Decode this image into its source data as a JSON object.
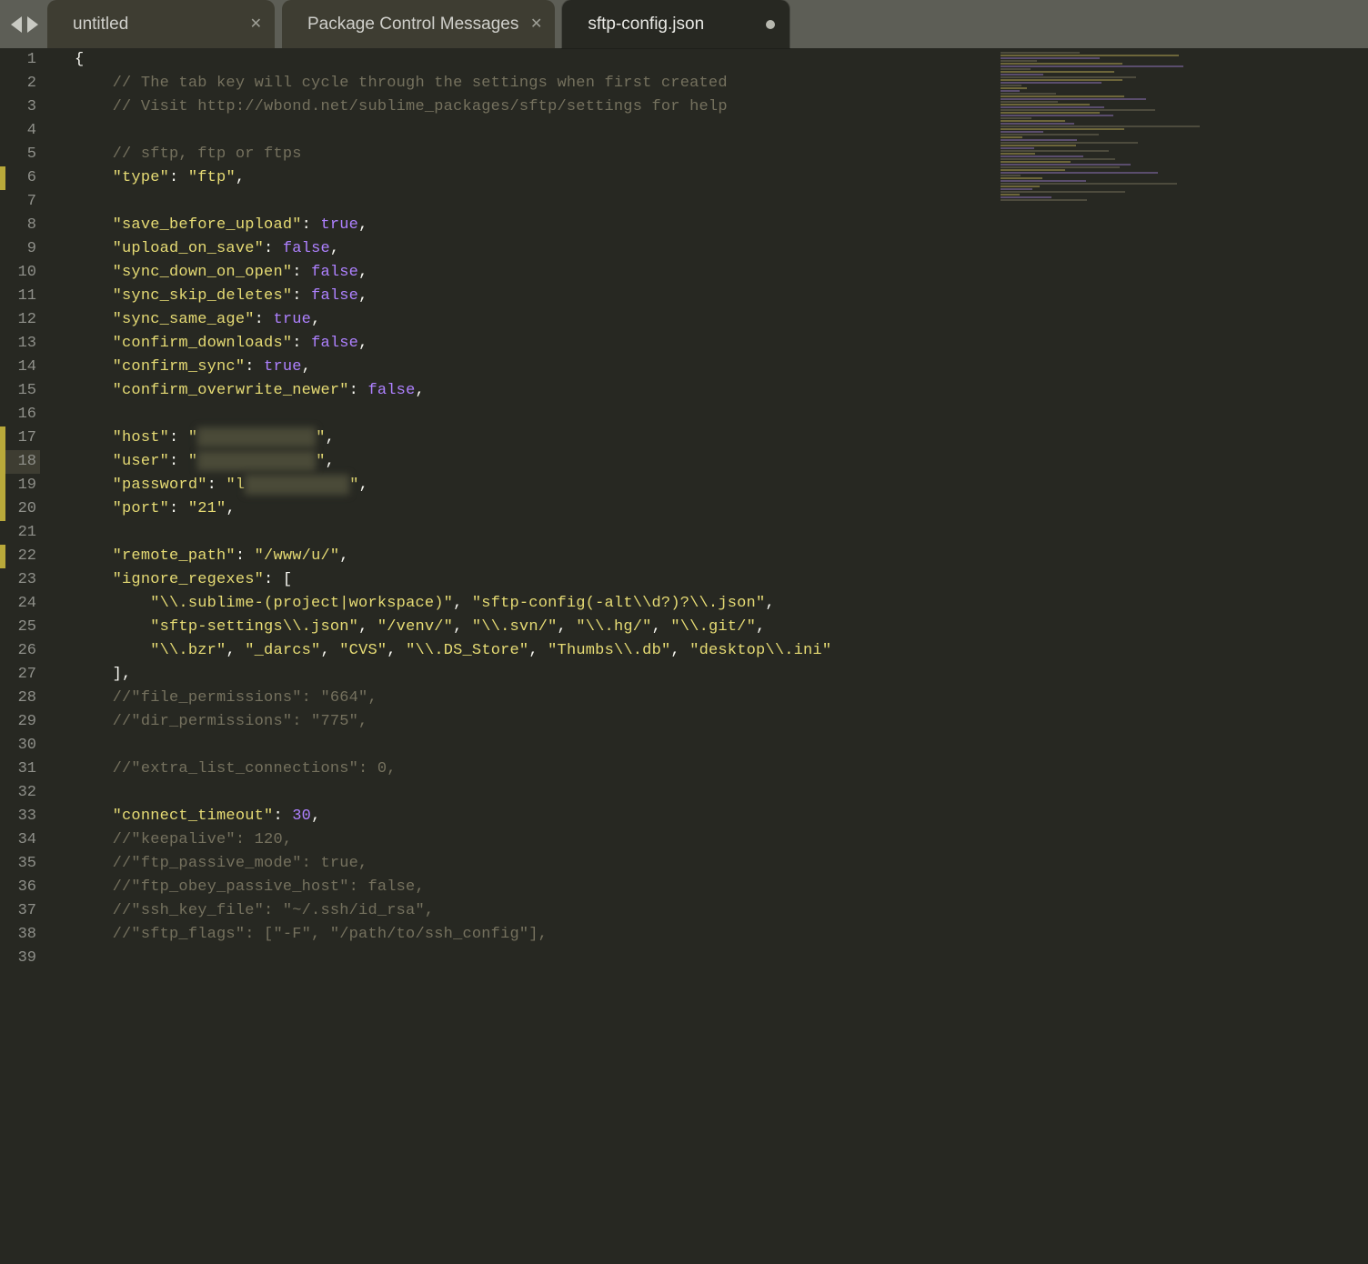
{
  "tabs": [
    {
      "label": "untitled",
      "closeable": true,
      "active": false
    },
    {
      "label": "Package Control Messages",
      "closeable": true,
      "active": false
    },
    {
      "label": "sftp-config.json",
      "closeable": false,
      "dirty": true,
      "active": true
    }
  ],
  "line_numbers": [
    "1",
    "2",
    "3",
    "4",
    "5",
    "6",
    "7",
    "8",
    "9",
    "10",
    "11",
    "12",
    "13",
    "14",
    "15",
    "16",
    "17",
    "18",
    "19",
    "20",
    "21",
    "22",
    "23",
    "24",
    "25",
    "26",
    "27",
    "28",
    "29",
    "30",
    "31",
    "32",
    "33",
    "34",
    "35",
    "36",
    "37",
    "38",
    "39"
  ],
  "modified_lines": [
    6,
    17,
    18,
    19,
    20,
    22
  ],
  "current_line": 18,
  "code": {
    "l1": "{",
    "c2": "// The tab key will cycle through the settings when first created",
    "c3": "// Visit http://wbond.net/sublime_packages/sftp/settings for help",
    "c5": "// sftp, ftp or ftps",
    "k6": "\"type\"",
    "v6": "\"ftp\"",
    "k8": "\"save_before_upload\"",
    "b8": "true",
    "k9": "\"upload_on_save\"",
    "b9": "false",
    "k10": "\"sync_down_on_open\"",
    "b10": "false",
    "k11": "\"sync_skip_deletes\"",
    "b11": "false",
    "k12": "\"sync_same_age\"",
    "b12": "true",
    "k13": "\"confirm_downloads\"",
    "b13": "false",
    "k14": "\"confirm_sync\"",
    "b14": "true",
    "k15": "\"confirm_overwrite_newer\"",
    "b15": "false",
    "k17": "\"host\"",
    "k18": "\"user\"",
    "k19": "\"password\"",
    "k20": "\"port\"",
    "v20": "\"21\"",
    "k22": "\"remote_path\"",
    "v22": "\"/www/u/\"",
    "k23": "\"ignore_regexes\"",
    "s24a": "\"\\\\.sublime-(project|workspace)\"",
    "s24b": "\"sftp-config(-alt\\\\d?)?\\\\.json\"",
    "s25a": "\"sftp-settings\\\\.json\"",
    "s25b": "\"/venv/\"",
    "s25c": "\"\\\\.svn/\"",
    "s25d": "\"\\\\.hg/\"",
    "s25e": "\"\\\\.git/\"",
    "s26a": "\"\\\\.bzr\"",
    "s26b": "\"_darcs\"",
    "s26c": "\"CVS\"",
    "s26d": "\"\\\\.DS_Store\"",
    "s26e": "\"Thumbs\\\\.db\"",
    "s26f": "\"desktop\\\\.ini\"",
    "c28": "//\"file_permissions\": \"664\",",
    "c29": "//\"dir_permissions\": \"775\",",
    "c31": "//\"extra_list_connections\": 0,",
    "k33": "\"connect_timeout\"",
    "b33": "30",
    "c34": "//\"keepalive\": 120,",
    "c35": "//\"ftp_passive_mode\": true,",
    "c36": "//\"ftp_obey_passive_host\": false,",
    "c37": "//\"ssh_key_file\": \"~/.ssh/id_rsa\",",
    "c38": "//\"sftp_flags\": [\"-F\", \"/path/to/ssh_config\"],"
  }
}
